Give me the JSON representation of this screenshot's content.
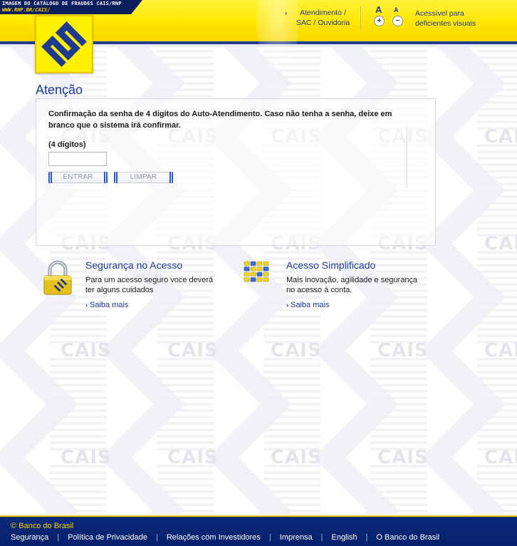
{
  "header": {
    "caption_line1": "IMAGEM DO CATÁLOGO DE FRAUDES CAIS/RNP",
    "caption_line2": "WWW.RNP.BR/CAIS/",
    "atendimento_link": "Atendimento / SAC / Ouvidoria",
    "font_size_large_label": "A",
    "font_size_small_label": "A",
    "font_increase": "+",
    "font_decrease": "−",
    "accessibility_link": "Acessível para deficientes visuais"
  },
  "watermark": {
    "text": "CAIS"
  },
  "main": {
    "title": "Atenção",
    "message": "Confirmação da senha de 4 digitos do Auto-Atendimento. Caso não tenha a senha, deixe em branco que o sistema irá confirmar.",
    "pin_label": "(4 dígitos)",
    "pin_value": "",
    "enter_button": "ENTRAR",
    "clear_button": "LIMPAR"
  },
  "features": [
    {
      "title": "Segurança no Acesso",
      "description": "Para um acesso seguro voce deverá ter alguns cuidados",
      "link": "Saiba mais",
      "icon": "padlock-icon"
    },
    {
      "title": "Acesso Simplificado",
      "description": "Mais inovação, agilidade e segurança no acesso à conta.",
      "link": "Saiba mais",
      "icon": "keypad-icon"
    }
  ],
  "footer": {
    "copyright": "© Banco do Brasil",
    "links": [
      "Segurança",
      "Política de Privacidade",
      "Relações com Investidores",
      "Imprensa",
      "English",
      "O Banco do Brasil"
    ]
  },
  "colors": {
    "brand_yellow": "#ffe600",
    "brand_blue": "#1f3a93",
    "footer_blue": "#0b2a7a"
  }
}
